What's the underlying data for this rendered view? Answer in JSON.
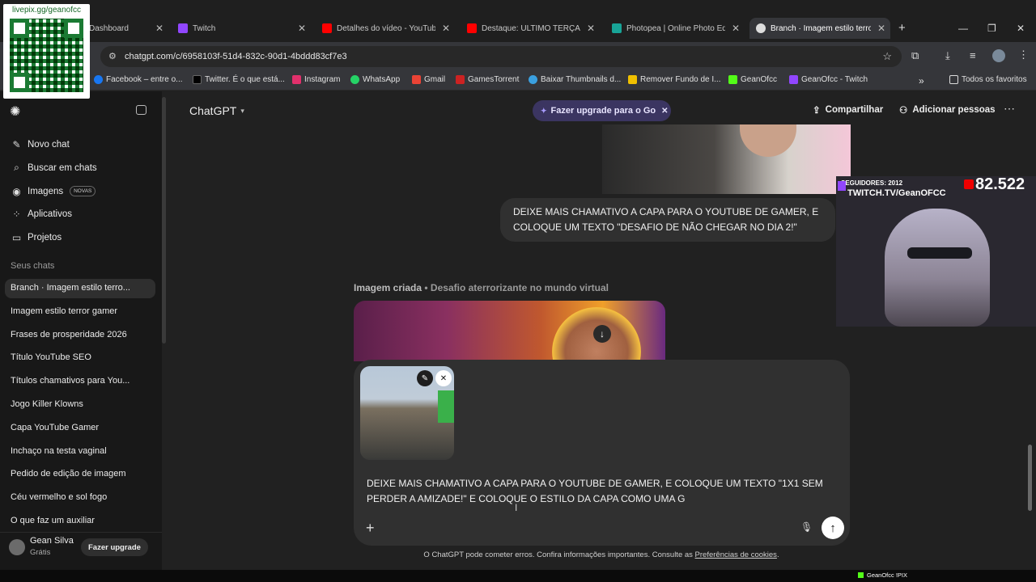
{
  "browser": {
    "tabs": [
      {
        "title": "Dashboard",
        "icon": "twitch-icon"
      },
      {
        "title": "Twitch",
        "icon": "twitch-icon"
      },
      {
        "title": "Detalhes do vídeo - YouTube",
        "icon": "youtube-icon"
      },
      {
        "title": "Destaque: ULTIMO TERÇA DI",
        "icon": "youtube-icon"
      },
      {
        "title": "Photopea | Online Photo Edi",
        "icon": "photopea-icon"
      },
      {
        "title": "Branch · Imagem estilo terror",
        "icon": "chatgpt-icon"
      }
    ],
    "url": "chatgpt.com/c/6958103f-51d4-832c-90d1-4bddd83cf7e3",
    "bookmarks": [
      {
        "label": "Facebook – entre o...",
        "color": "#1877f2"
      },
      {
        "label": "Twitter. É o que está...",
        "color": "#000000"
      },
      {
        "label": "Instagram",
        "color": "#e1306c"
      },
      {
        "label": "WhatsApp",
        "color": "#25d366"
      },
      {
        "label": "Gmail",
        "color": "#ea4335"
      },
      {
        "label": "GamesTorrent",
        "color": "#cc2222"
      },
      {
        "label": "Baixar Thumbnails d...",
        "color": "#3aa0e0"
      },
      {
        "label": "Remover Fundo de I...",
        "color": "#f0c000"
      },
      {
        "label": "GeanOfcc",
        "color": "#53fc18"
      },
      {
        "label": "GeanOfcc - Twitch",
        "color": "#9146ff"
      }
    ],
    "all_favorites": "Todos os favoritos"
  },
  "sidebar": {
    "nav": [
      {
        "label": "Novo chat",
        "icon": "edit-icon"
      },
      {
        "label": "Buscar em chats",
        "icon": "search-icon"
      },
      {
        "label": "Imagens",
        "icon": "image-icon",
        "badge": "NOVAS"
      },
      {
        "label": "Aplicativos",
        "icon": "apps-icon"
      },
      {
        "label": "Projetos",
        "icon": "folder-icon"
      }
    ],
    "section_title": "Seus chats",
    "chats": [
      "Branch · Imagem estilo terro...",
      "Imagem estilo terror gamer",
      "Frases de prosperidade 2026",
      "Título YouTube SEO",
      "Títulos chamativos para You...",
      "Jogo Killer Klowns",
      "Capa YouTube Gamer",
      "Inchaço na testa vaginal",
      "Pedido de edição de imagem",
      "Céu vermelho e sol fogo",
      "O que faz um auxiliar"
    ],
    "user": {
      "name": "Gean Silva",
      "plan": "Grátis",
      "upgrade": "Fazer upgrade"
    }
  },
  "header": {
    "model": "ChatGPT",
    "upgrade_pill": "Fazer upgrade para o Go",
    "share": "Compartilhar",
    "add_people": "Adicionar pessoas"
  },
  "conversation": {
    "user_message": "DEIXE MAIS CHAMATIVO A CAPA PARA O YOUTUBE DE GAMER, E COLOQUE UM TEXTO \"DESAFIO DE NÃO CHEGAR NO DIA 2!\"",
    "image_caption_label": "Imagem criada",
    "image_caption_title": "• Desafio aterrorizante no mundo virtual"
  },
  "composer": {
    "text": "DEIXE MAIS CHAMATIVO A CAPA PARA O YOUTUBE DE GAMER, E COLOQUE UM TEXTO \"1X1 SEM PERDER A AMIZADE!\" E COLOQUE O ESTILO DA CAPA COMO UMA G"
  },
  "footer": {
    "text": "O ChatGPT pode cometer erros. Confira informações importantes. Consulte as ",
    "link": "Preferências de cookies",
    "end": "."
  },
  "overlays": {
    "qr_label": "livepix.gg/geanofcc",
    "followers": "SEGUIDORES: 2012",
    "channel": "TWITCH.TV/GeanOFCC",
    "viewers": "82.522",
    "taskbar": "GeanOfcc !PIX"
  }
}
